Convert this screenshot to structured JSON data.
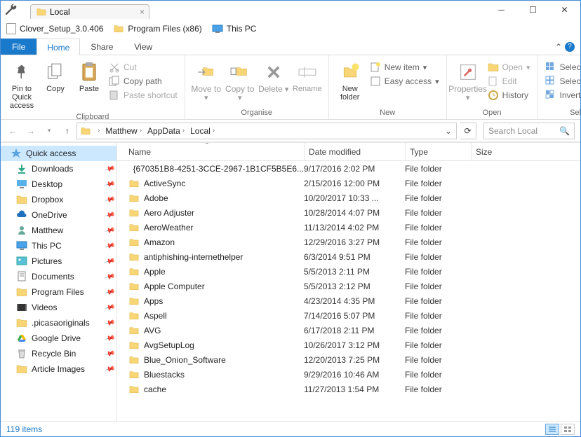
{
  "tab": {
    "title": "Local"
  },
  "bookmarks": [
    {
      "label": "Clover_Setup_3.0.406",
      "icon": "file"
    },
    {
      "label": "Program Files (x86)",
      "icon": "folder"
    },
    {
      "label": "This PC",
      "icon": "pc"
    }
  ],
  "ribbon": {
    "file_label": "File",
    "tabs": [
      "Home",
      "Share",
      "View"
    ],
    "active_tab": "Home",
    "groups": {
      "clipboard": {
        "label": "Clipboard",
        "pin": "Pin to Quick access",
        "copy": "Copy",
        "paste": "Paste",
        "cut": "Cut",
        "copy_path": "Copy path",
        "paste_shortcut": "Paste shortcut"
      },
      "organise": {
        "label": "Organise",
        "move_to": "Move to",
        "copy_to": "Copy to",
        "delete": "Delete",
        "rename": "Rename"
      },
      "new": {
        "label": "New",
        "new_folder": "New folder",
        "new_item": "New item",
        "easy_access": "Easy access"
      },
      "open": {
        "label": "Open",
        "properties": "Properties",
        "open": "Open",
        "edit": "Edit",
        "history": "History"
      },
      "select": {
        "label": "Select",
        "select_all": "Select all",
        "select_none": "Select none",
        "invert": "Invert selection"
      }
    }
  },
  "breadcrumb": [
    "Matthew",
    "AppData",
    "Local"
  ],
  "search_placeholder": "Search Local",
  "columns": {
    "name": "Name",
    "date": "Date modified",
    "type": "Type",
    "size": "Size"
  },
  "sidebar": [
    {
      "label": "Quick access",
      "icon": "star",
      "selected": true,
      "header": true
    },
    {
      "label": "Downloads",
      "icon": "down",
      "pinned": true
    },
    {
      "label": "Desktop",
      "icon": "desktop",
      "pinned": true
    },
    {
      "label": "Dropbox",
      "icon": "folder",
      "pinned": true
    },
    {
      "label": "OneDrive",
      "icon": "cloud",
      "pinned": true
    },
    {
      "label": "Matthew",
      "icon": "user",
      "pinned": true
    },
    {
      "label": "This PC",
      "icon": "pc",
      "pinned": true
    },
    {
      "label": "Pictures",
      "icon": "pics",
      "pinned": true
    },
    {
      "label": "Documents",
      "icon": "docs",
      "pinned": true
    },
    {
      "label": "Program Files",
      "icon": "folder",
      "pinned": true
    },
    {
      "label": "Videos",
      "icon": "vids",
      "pinned": true
    },
    {
      "label": ".picasaoriginals",
      "icon": "folder",
      "pinned": true
    },
    {
      "label": "Google Drive",
      "icon": "gdrive",
      "pinned": true
    },
    {
      "label": "Recycle Bin",
      "icon": "trash",
      "pinned": true
    },
    {
      "label": "Article Images",
      "icon": "folder",
      "pinned": true
    }
  ],
  "files": [
    {
      "name": "{670351B8-4251-3CCE-2967-1B1CF5B5E6...",
      "date": "9/17/2016 2:02 PM",
      "type": "File folder"
    },
    {
      "name": "ActiveSync",
      "date": "2/15/2016 12:00 PM",
      "type": "File folder"
    },
    {
      "name": "Adobe",
      "date": "10/20/2017 10:33 ...",
      "type": "File folder"
    },
    {
      "name": "Aero Adjuster",
      "date": "10/28/2014 4:07 PM",
      "type": "File folder"
    },
    {
      "name": "AeroWeather",
      "date": "11/13/2014 4:02 PM",
      "type": "File folder"
    },
    {
      "name": "Amazon",
      "date": "12/29/2016 3:27 PM",
      "type": "File folder"
    },
    {
      "name": "antiphishing-internethelper",
      "date": "6/3/2014 9:51 PM",
      "type": "File folder"
    },
    {
      "name": "Apple",
      "date": "5/5/2013 2:11 PM",
      "type": "File folder"
    },
    {
      "name": "Apple Computer",
      "date": "5/5/2013 2:12 PM",
      "type": "File folder"
    },
    {
      "name": "Apps",
      "date": "4/23/2014 4:35 PM",
      "type": "File folder"
    },
    {
      "name": "Aspell",
      "date": "7/14/2016 5:07 PM",
      "type": "File folder"
    },
    {
      "name": "AVG",
      "date": "6/17/2018 2:11 PM",
      "type": "File folder"
    },
    {
      "name": "AvgSetupLog",
      "date": "10/26/2017 3:12 PM",
      "type": "File folder"
    },
    {
      "name": "Blue_Onion_Software",
      "date": "12/20/2013 7:25 PM",
      "type": "File folder"
    },
    {
      "name": "Bluestacks",
      "date": "9/29/2016 10:46 AM",
      "type": "File folder"
    },
    {
      "name": "cache",
      "date": "11/27/2013 1:54 PM",
      "type": "File folder"
    }
  ],
  "status": {
    "item_count": "119 items"
  }
}
